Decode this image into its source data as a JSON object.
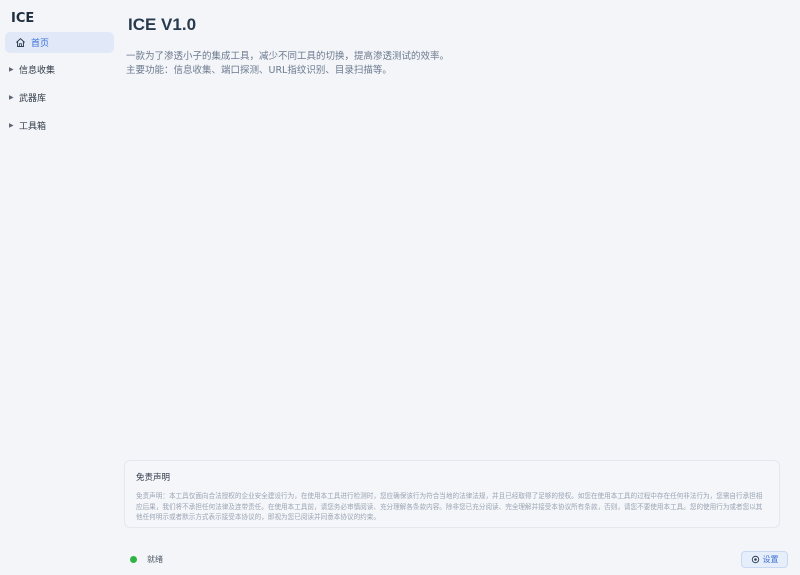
{
  "app": {
    "title": "ICE"
  },
  "sidebar": {
    "home": {
      "label": "首页",
      "icon": "home-icon",
      "active": true
    },
    "items": [
      {
        "label": "信息收集",
        "icon": "caret-right-icon"
      },
      {
        "label": "武器库",
        "icon": "caret-right-icon"
      },
      {
        "label": "工具箱",
        "icon": "caret-right-icon"
      }
    ]
  },
  "main": {
    "title": "ICE V1.0",
    "description_line1": "一款为了渗透小子的集成工具，减少不同工具的切换，提高渗透测试的效率。",
    "description_line2": "主要功能：信息收集、端口探测、URL指纹识别、目录扫描等。"
  },
  "disclaimer": {
    "title": "免责声明",
    "text": "免责声明：本工具仅面向合法授权的企业安全建设行为，在使用本工具进行检测时，您应确保该行为符合当地的法律法规，并且已经取得了足够的授权。如您在使用本工具的过程中存在任何非法行为，您需自行承担相应后果，我们将不承担任何法律及连带责任。在使用本工具前，请您务必审慎阅读、充分理解各条款内容。除非您已充分阅读、完全理解并接受本协议所有条款，否则，请您不要使用本工具。您的使用行为或者您以其他任何明示或者默示方式表示接受本协议的，即视为您已阅读并同意本协议的约束。"
  },
  "status": {
    "text": "就绪",
    "color": "#2fb344"
  },
  "settings": {
    "label": "设置",
    "icon": "gear-icon"
  },
  "colors": {
    "accent": "#3a6fd8",
    "background": "#f3f5f9"
  }
}
